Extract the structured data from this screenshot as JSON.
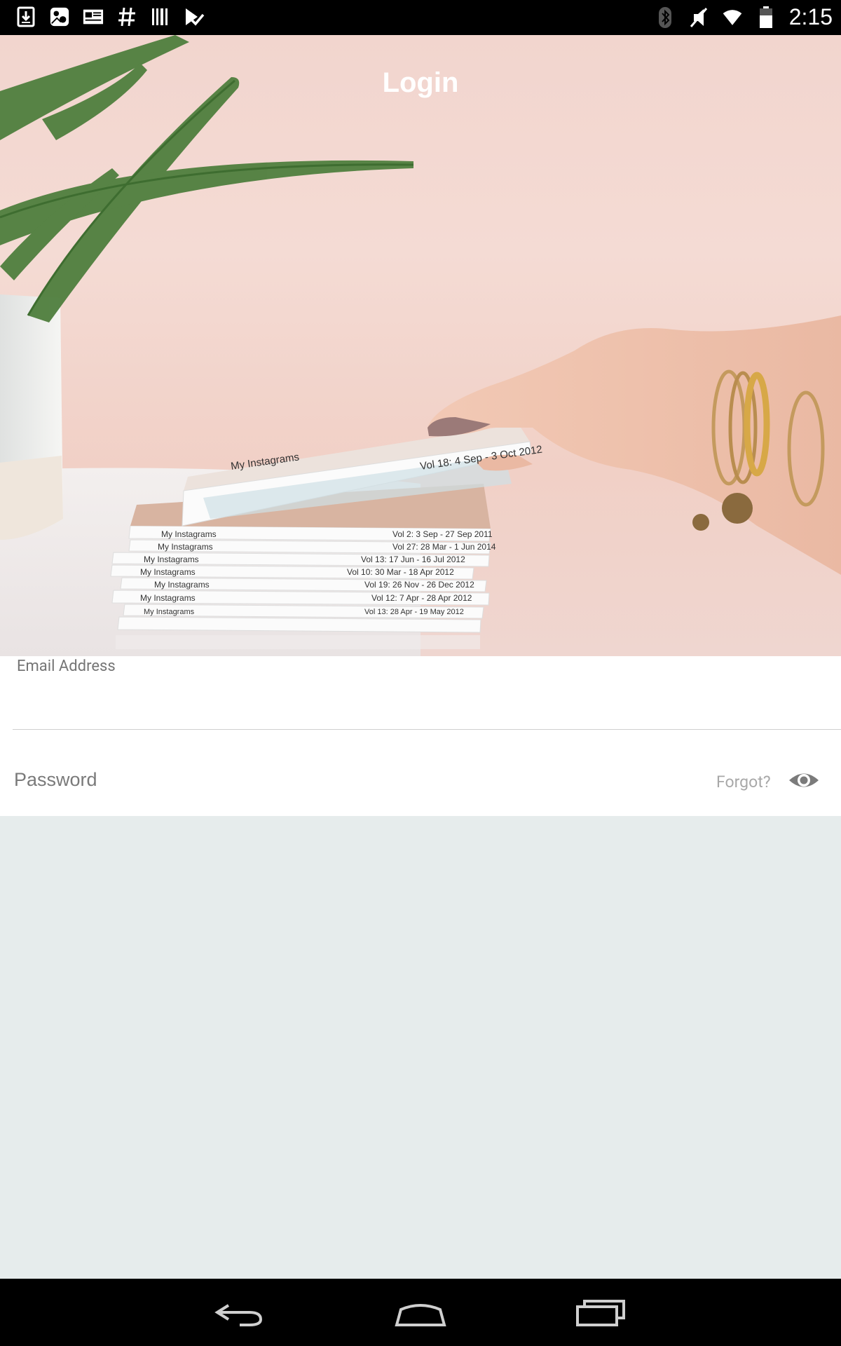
{
  "status_bar": {
    "time": "2:15",
    "left_icons": [
      "download-icon",
      "gallery-icon",
      "news-icon",
      "hashtag-icon",
      "barcode-icon",
      "checklist-icon"
    ],
    "right_icons": [
      "bluetooth-icon",
      "mute-icon",
      "wifi-icon",
      "battery-icon"
    ]
  },
  "header": {
    "title": "Login"
  },
  "hero": {
    "book_spines": [
      {
        "left": "My Instagrams",
        "right": "Vol 18: 4 Sep - 3 Oct 2012"
      },
      {
        "left": "My Instagrams",
        "right": ""
      },
      {
        "left": "My Instagrams",
        "right": "Vol 2: 3 Sep - 27 Sep 2011"
      },
      {
        "left": "My Instagrams",
        "right": "Vol 27: 28 Mar - 1 Jun 2014"
      },
      {
        "left": "My Instagrams",
        "right": "Vol 13: 17 Jun - 16 Jul 2012"
      },
      {
        "left": "My Instagrams",
        "right": "Vol 10: 30 Mar - 18 Apr 2012"
      },
      {
        "left": "My Instagrams",
        "right": "Vol 19: 26 Nov - 26 Dec 2012"
      },
      {
        "left": "My Instagrams",
        "right": "Vol 12: 7 Apr - 28 Apr 2012"
      },
      {
        "left": "My Instagrams",
        "right": "Vol 13: 28 Apr - 19 May 2012"
      }
    ]
  },
  "form": {
    "email_label": "Email Address",
    "email_value": "",
    "password_placeholder": "Password",
    "forgot_label": "Forgot?",
    "toggle_icon": "eye-icon"
  },
  "nav_bar": {
    "buttons": [
      "back-icon",
      "home-icon",
      "recents-icon"
    ]
  },
  "colors": {
    "status_bar": "#000000",
    "form_bg": "#ffffff",
    "page_bg": "#e6ecec",
    "hint": "#a8a8a8"
  }
}
